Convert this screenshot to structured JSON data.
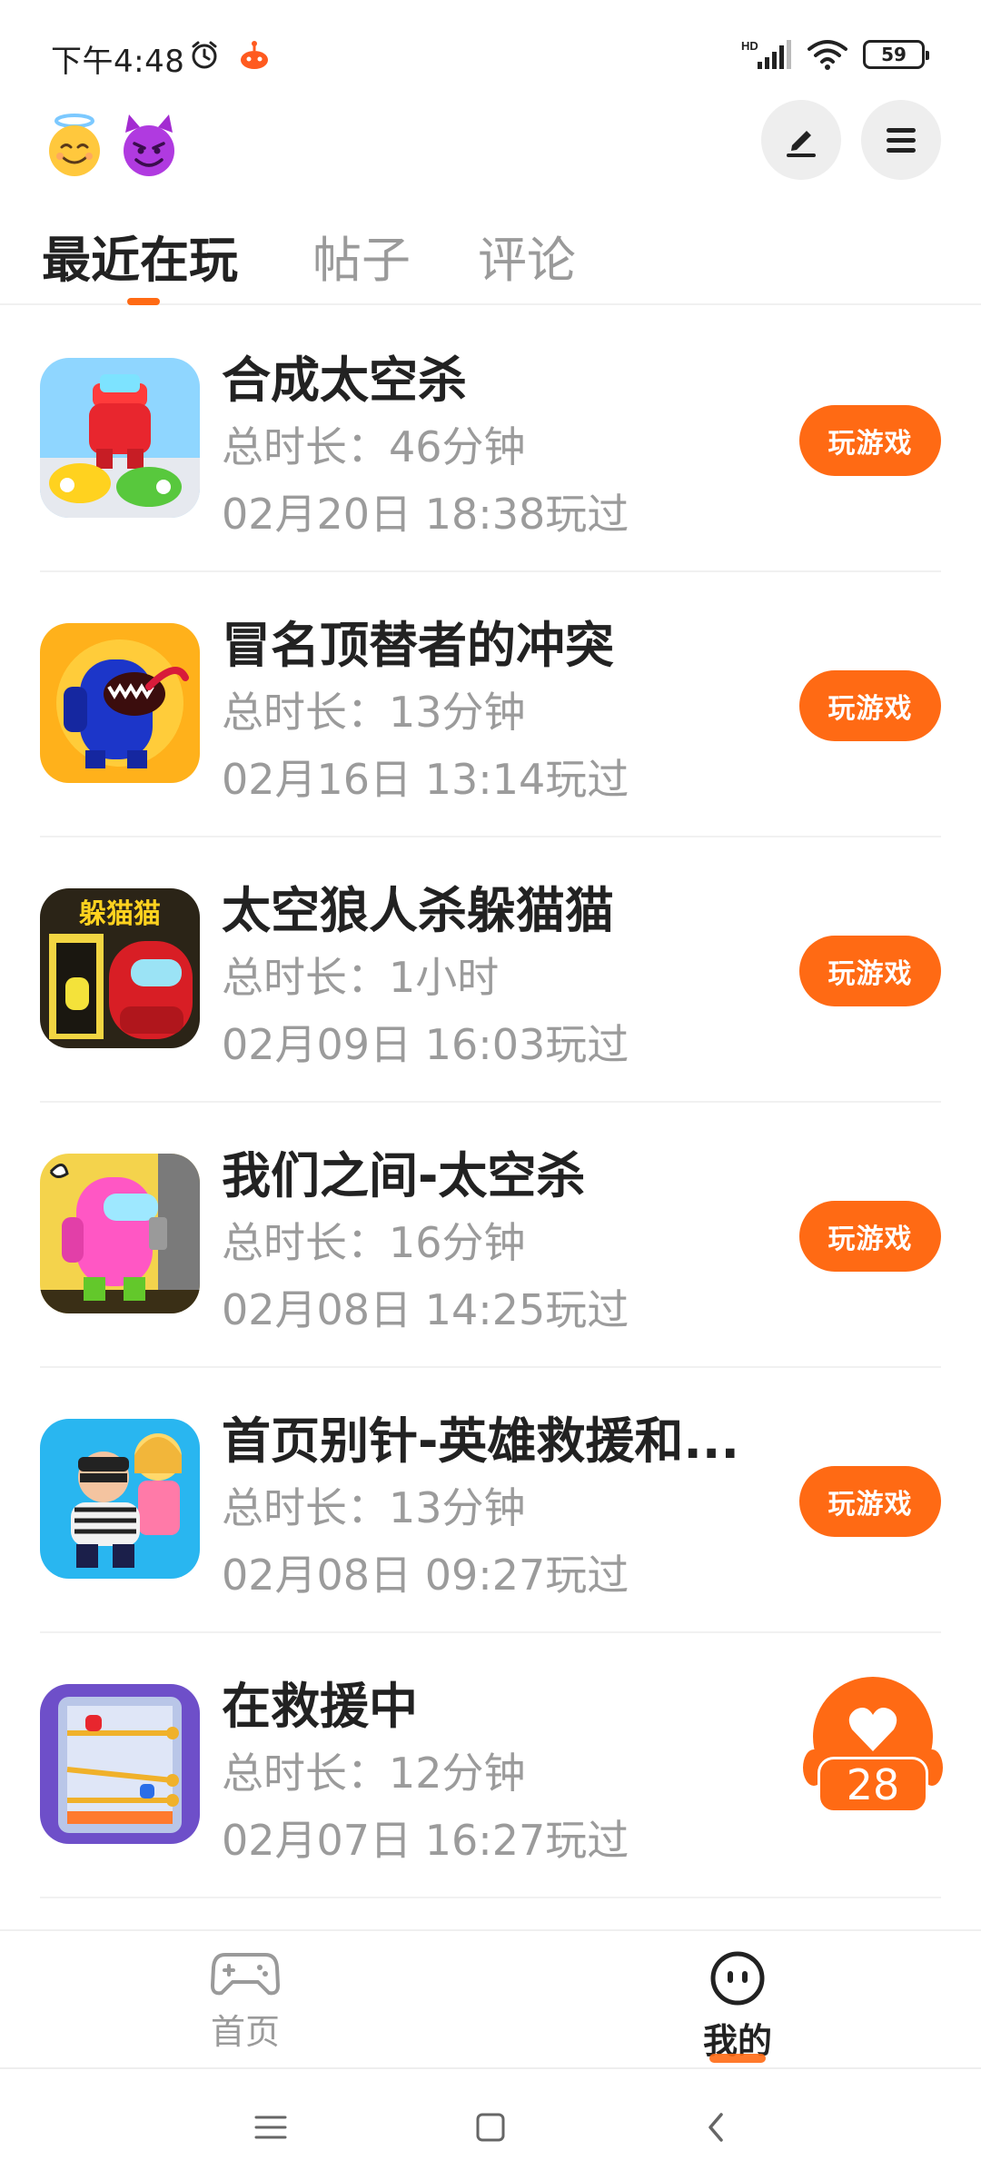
{
  "status_bar": {
    "time": "下午4:48",
    "network_label": "HD",
    "battery": "59",
    "icons": [
      "alarm-icon",
      "app-notification-icon",
      "signal-icon",
      "wifi-icon",
      "battery-icon"
    ]
  },
  "header": {
    "emojis": [
      "angel-face-icon",
      "devil-face-icon"
    ],
    "actions": [
      "edit-icon",
      "menu-icon"
    ]
  },
  "tabs": [
    {
      "label": "最近在玩",
      "active": true
    },
    {
      "label": "帖子",
      "active": false
    },
    {
      "label": "评论",
      "active": false
    }
  ],
  "games": [
    {
      "title": "合成太空杀",
      "duration": "总时长：46分钟",
      "last_played": "02月20日 18:38玩过",
      "button": "玩游戏"
    },
    {
      "title": "冒名顶替者的冲突",
      "duration": "总时长：13分钟",
      "last_played": "02月16日 13:14玩过",
      "button": "玩游戏"
    },
    {
      "title": "太空狼人杀躲猫猫",
      "duration": "总时长：1小时",
      "last_played": "02月09日 16:03玩过",
      "button": "玩游戏",
      "icon_text": "躲猫猫"
    },
    {
      "title": "我们之间-太空杀",
      "duration": "总时长：16分钟",
      "last_played": "02月08日 14:25玩过",
      "button": "玩游戏"
    },
    {
      "title": "首页别针-英雄救援和...",
      "duration": "总时长：13分钟",
      "last_played": "02月08日 09:27玩过",
      "button": "玩游戏"
    },
    {
      "title": "在救援中",
      "duration": "总时长：12分钟",
      "last_played": "02月07日 16:27玩过"
    }
  ],
  "heart_badge": {
    "count": "28"
  },
  "bottom_nav": {
    "home_label": "首页",
    "mine_label": "我的",
    "active": "mine"
  },
  "colors": {
    "accent": "#ff6a14",
    "text_primary": "#222222",
    "text_secondary": "#9b9b9b"
  }
}
